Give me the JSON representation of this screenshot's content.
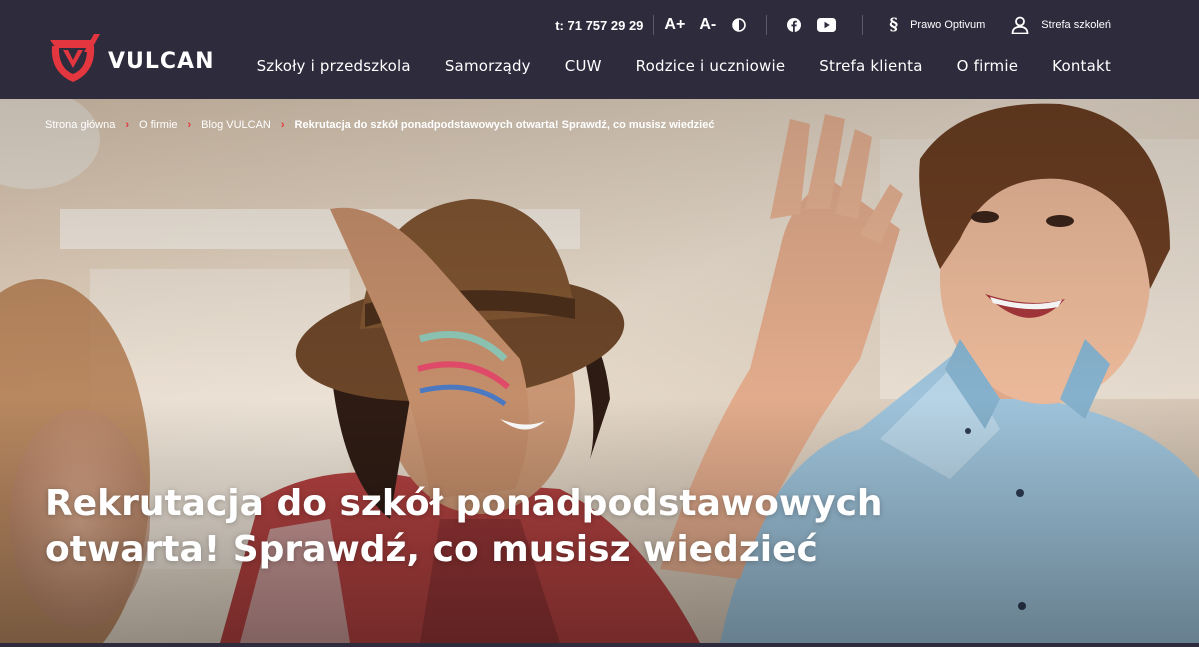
{
  "brand": {
    "name": "VULCAN",
    "accent": "#e3363f",
    "header_bg": "#2d2b3c"
  },
  "topbar": {
    "phone_prefix": "t:",
    "phone": "71 757 29 29",
    "font_increase": "A+",
    "font_decrease": "A-",
    "contrast_icon": "contrast-icon",
    "social": [
      "facebook-icon",
      "youtube-icon"
    ],
    "prawo_label": "Prawo Optivum",
    "prawo_icon": "paragraph-icon",
    "szkolen_label": "Strefa szkoleń",
    "szkolen_icon": "user-icon"
  },
  "nav": {
    "items": [
      {
        "label": "Szkoły i przedszkola"
      },
      {
        "label": "Samorządy"
      },
      {
        "label": "CUW"
      },
      {
        "label": "Rodzice i uczniowie"
      },
      {
        "label": "Strefa klienta"
      },
      {
        "label": "O firmie"
      },
      {
        "label": "Kontakt"
      }
    ]
  },
  "breadcrumb": {
    "items": [
      "Strona główna",
      "O firmie",
      "Blog VULCAN"
    ],
    "current": "Rekrutacja do szkół ponadpodstawowych otwarta! Sprawdź, co musisz wiedzieć"
  },
  "hero": {
    "title_line1": "Rekrutacja do szkół ponadpodstawowych",
    "title_line2": "otwarta! Sprawdź, co musisz wiedzieć"
  }
}
